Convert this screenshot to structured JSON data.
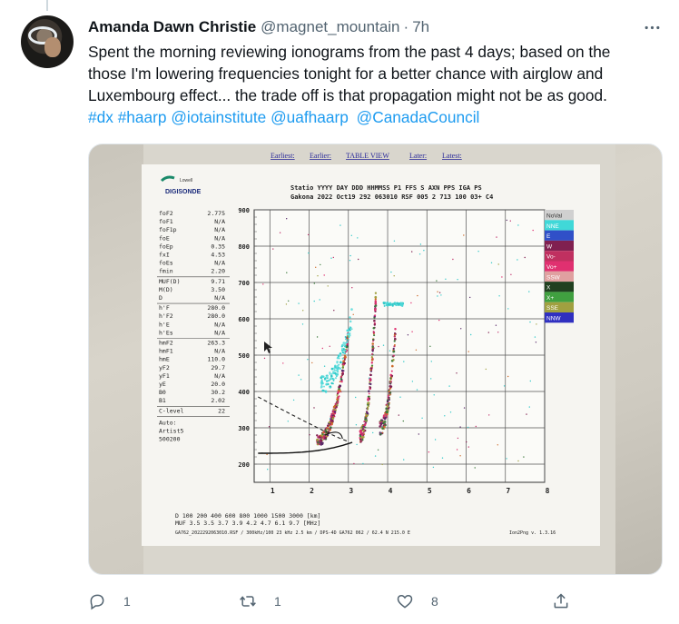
{
  "tweet": {
    "author_name": "Amanda Dawn Christie",
    "author_handle": "@magnet_mountain",
    "separator": "·",
    "time": "7h",
    "more_label": "•••",
    "text_lines": [
      "Spent the morning reviewing ionograms from the past 4 days; based on the",
      "those I'm lowering frequencies tonight for a better chance with airglow and",
      "Luxembourg effect... the trade off is that propagation might not be as good."
    ],
    "tags": [
      "#dx",
      "#haarp",
      "@iotainstitute",
      "@uafhaarp",
      "@CanadaCouncil"
    ],
    "reply_count": "1",
    "retweet_count": "1",
    "like_count": "8"
  },
  "icons": {
    "more": "more-horizontal-icon",
    "reply": "reply-bubble-icon",
    "retweet": "retweet-arrows-icon",
    "like": "heart-icon",
    "share": "share-upload-icon"
  },
  "colors": {
    "link": "#1d9bf0",
    "muted": "#536471",
    "text": "#0f1419"
  },
  "ionogram": {
    "nav": [
      "Earliest:",
      "Earlier:",
      "TABLE VIEW",
      "Later:",
      "Latest:"
    ],
    "logo_top": "Lowell",
    "logo_main": "DIGISONDE",
    "header_line1": "Statio YYYY DAY  DDD HHMMSS P1  FFS S AXN PPS IGA PS",
    "header_line2": "Gakona 2022 Oct19 292 063010 RSF 005 2 713 100 03+ C4",
    "params": [
      [
        "foF2",
        "2.775"
      ],
      [
        "foF1",
        "N/A"
      ],
      [
        "foF1p",
        "N/A"
      ],
      [
        "foE",
        "N/A"
      ],
      [
        "foEp",
        "0.35"
      ],
      [
        "fxI",
        "4.53"
      ],
      [
        "foEs",
        "N/A"
      ],
      [
        "fmin",
        "2.20"
      ],
      [
        "MUF(D)",
        "9.71"
      ],
      [
        "M(D)",
        "3.50"
      ],
      [
        "D",
        "N/A"
      ],
      [
        "h'F",
        "280.0"
      ],
      [
        "h'F2",
        "280.0"
      ],
      [
        "h'E",
        "N/A"
      ],
      [
        "h'Es",
        "N/A"
      ],
      [
        "hmF2",
        "263.3"
      ],
      [
        "hmF1",
        "N/A"
      ],
      [
        "hmE",
        "110.0"
      ],
      [
        "yF2",
        "29.7"
      ],
      [
        "yF1",
        "N/A"
      ],
      [
        "yE",
        "20.0"
      ],
      [
        "B0",
        "30.2"
      ],
      [
        "B1",
        "2.02"
      ],
      [
        "C-level",
        "22"
      ]
    ],
    "auto_lines": [
      "Auto:",
      "Artist5",
      "500200"
    ],
    "y_ticks": [
      "900",
      "800",
      "700",
      "600",
      "500",
      "400",
      "300",
      "200"
    ],
    "x_ticks": [
      "1",
      "2",
      "3",
      "4",
      "5",
      "6",
      "7",
      "8"
    ],
    "legend": [
      "NoVal",
      "NNE",
      "E",
      "W",
      "Vo-",
      "Vo+",
      "SSW",
      "X",
      "X+",
      "SSE",
      "NNW"
    ],
    "legend_colors": [
      "#d0d0d0",
      "#40d8d8",
      "#3050c8",
      "#802050",
      "#c03060",
      "#e03070",
      "#e0a0a0",
      "#204020",
      "#40a040",
      "#a0a040",
      "#3030c0"
    ],
    "footer_d": "D     100   200   400   600   800  1000  1500  3000 [km]",
    "footer_muf": "MUF   3.5   3.5   3.7   3.9   4.2   4.7   6.1   9.7 [MHz]",
    "footer_file": "GA762_2022292063010.RSF / 300kHz/100 23 kHz 2.5 km / DPS-4D GA762 062 / 62.4 N 215.0 E",
    "footer_version": "Ion2Png v. 1.3.16"
  }
}
